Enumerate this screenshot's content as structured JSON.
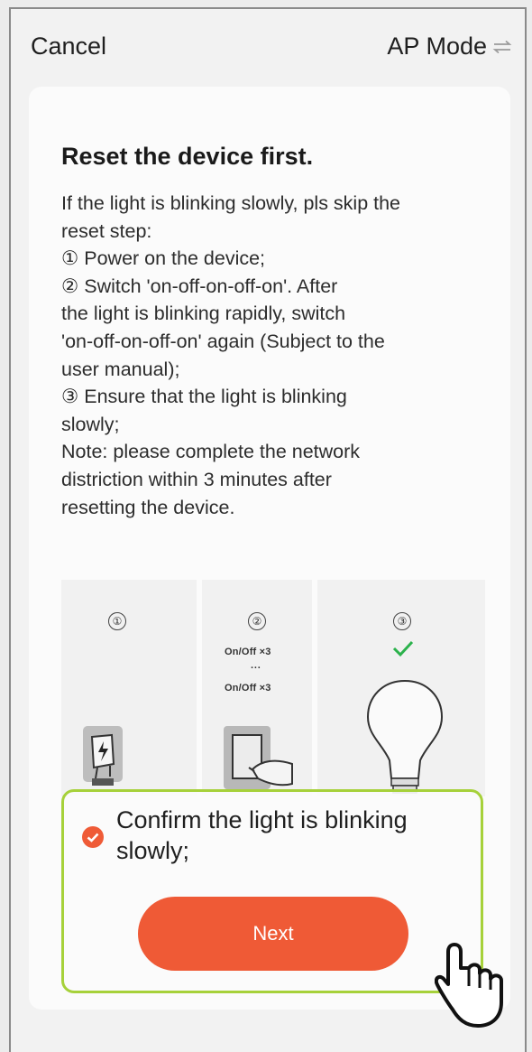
{
  "header": {
    "cancel_label": "Cancel",
    "mode_label": "AP Mode",
    "mode_icon": "swap-arrows-icon"
  },
  "instructions": {
    "title": "Reset the device first.",
    "lines": [
      "If the light is blinking slowly, pls skip the",
      "reset step:",
      "① Power on the device;",
      "② Switch 'on-off-on-off-on'. After",
      "the light is blinking rapidly, switch",
      "'on-off-on-off-on' again (Subject to the",
      "user manual);",
      "③ Ensure that the light is blinking",
      "slowly;",
      "Note: please complete the network",
      "distriction within 3 minutes after",
      "resetting the device."
    ]
  },
  "illustration": {
    "step1": "①",
    "step2": "②",
    "step3": "③",
    "onoff_1": "On/Off ×3",
    "dots": "···",
    "onoff_2": "On/Off ×3",
    "icons": [
      "charger-icon",
      "wall-switch-icon",
      "hand-icon",
      "checkmark-icon",
      "light-bulb-icon"
    ]
  },
  "confirm": {
    "checkbox_text": "Confirm the light is blinking slowly;",
    "checked": true,
    "next_label": "Next"
  },
  "colors": {
    "accent": "#ef5a36",
    "highlight_border": "#a6d13a",
    "check_green": "#2bb24c"
  },
  "overlay": {
    "cursor_icon": "pointing-hand-cursor-icon"
  }
}
